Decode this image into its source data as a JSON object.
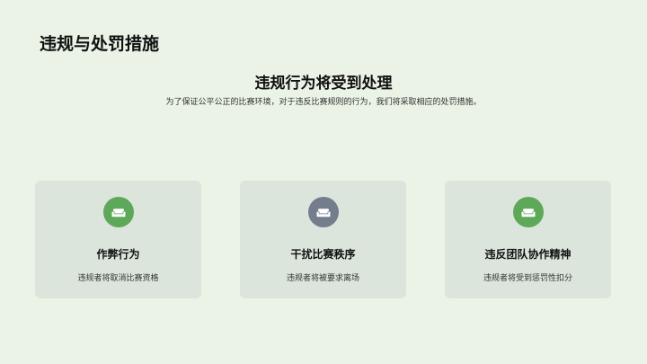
{
  "slide_title": "违规与处罚措施",
  "headline": "违规行为将受到处理",
  "subtitle": "为了保证公平公正的比赛环境，对于违反比赛规则的行为，我们将采取相应的处罚措施。",
  "cards": [
    {
      "title": "作弊行为",
      "description": "违规者将取消比赛资格",
      "icon": "sofa-icon",
      "icon_color": "#5ea85a"
    },
    {
      "title": "干扰比赛秩序",
      "description": "违规者将被要求离场",
      "icon": "sofa-icon",
      "icon_color": "#737d8c"
    },
    {
      "title": "违反团队协作精神",
      "description": "违规者将受到惩罚性扣分",
      "icon": "sofa-icon",
      "icon_color": "#5ea85a"
    }
  ]
}
